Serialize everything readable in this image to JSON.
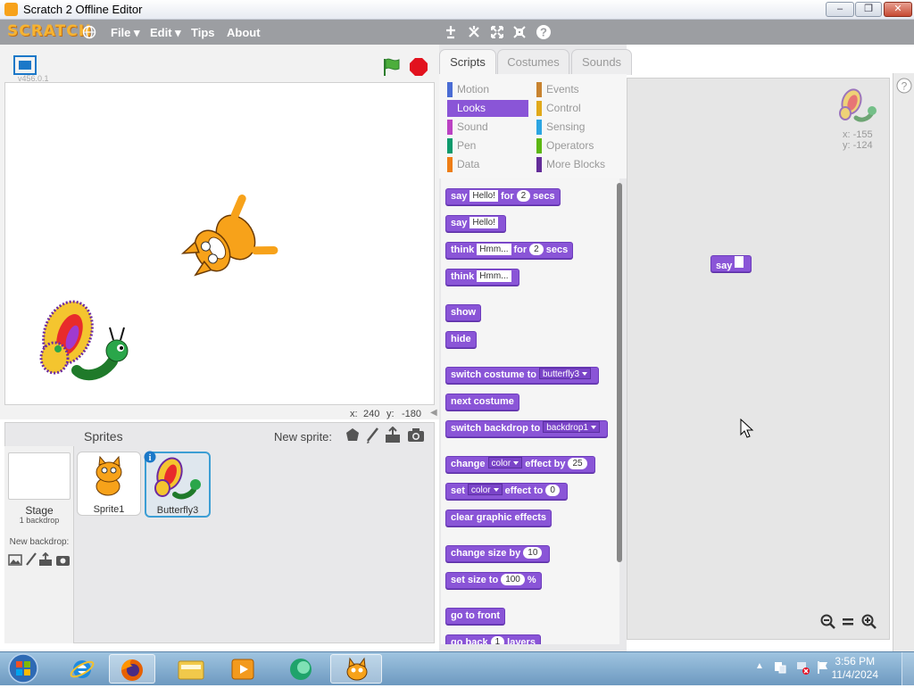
{
  "window": {
    "title": "Scratch 2 Offline Editor",
    "controls": {
      "minimize": "–",
      "maximize": "❐",
      "close": "✕"
    }
  },
  "menubar": {
    "logo": "SCRATCH",
    "items": [
      "File",
      "Edit",
      "Tips",
      "About"
    ],
    "tools": [
      "duplicate-icon",
      "delete-icon",
      "grow-icon",
      "shrink-icon",
      "help-icon"
    ]
  },
  "stage": {
    "version": "v456.0.1",
    "mouse_x_label": "x:",
    "mouse_x": "240",
    "mouse_y_label": "y:",
    "mouse_y": "-180"
  },
  "sprites_pane": {
    "title": "Sprites",
    "new_sprite_label": "New sprite:",
    "stage_label": "Stage",
    "stage_sub": "1 backdrop",
    "new_backdrop_label": "New backdrop:",
    "sprites": [
      {
        "name": "Sprite1",
        "selected": false
      },
      {
        "name": "Butterfly3",
        "selected": true
      }
    ]
  },
  "tabs": [
    "Scripts",
    "Costumes",
    "Sounds"
  ],
  "active_tab": "Scripts",
  "categories": [
    {
      "label": "Motion",
      "color": "#4a6cd4"
    },
    {
      "label": "Events",
      "color": "#c88330"
    },
    {
      "label": "Looks",
      "color": "#8a55d7"
    },
    {
      "label": "Control",
      "color": "#e1a91a"
    },
    {
      "label": "Sound",
      "color": "#bb42c3"
    },
    {
      "label": "Sensing",
      "color": "#2ca5e2"
    },
    {
      "label": "Pen",
      "color": "#0e9a6c"
    },
    {
      "label": "Operators",
      "color": "#5cb712"
    },
    {
      "label": "Data",
      "color": "#ee7d16"
    },
    {
      "label": "More Blocks",
      "color": "#632d99"
    }
  ],
  "active_category": "Looks",
  "blocks": {
    "say_for": {
      "w1": "say",
      "v1": "Hello!",
      "w2": "for",
      "v2": "2",
      "w3": "secs"
    },
    "say": {
      "w1": "say",
      "v1": "Hello!"
    },
    "think_for": {
      "w1": "think",
      "v1": "Hmm...",
      "w2": "for",
      "v2": "2",
      "w3": "secs"
    },
    "think": {
      "w1": "think",
      "v1": "Hmm..."
    },
    "show": "show",
    "hide": "hide",
    "switch_costume": {
      "w1": "switch costume to",
      "v1": "butterfly3"
    },
    "next_costume": "next costume",
    "switch_backdrop": {
      "w1": "switch backdrop to",
      "v1": "backdrop1"
    },
    "change_effect": {
      "w1": "change",
      "v1": "color",
      "w2": "effect by",
      "v2": "25"
    },
    "set_effect": {
      "w1": "set",
      "v1": "color",
      "w2": "effect to",
      "v2": "0"
    },
    "clear_effects": "clear graphic effects",
    "change_size": {
      "w1": "change size by",
      "v1": "10"
    },
    "set_size": {
      "w1": "set size to",
      "v1": "100",
      "w2": "%"
    },
    "go_front": "go to front",
    "go_back": {
      "w1": "go back",
      "v1": "1",
      "w2": "layers"
    }
  },
  "script_area": {
    "sprite_x": "x: -155",
    "sprite_y": "y: -124",
    "placed_block": {
      "w1": "say",
      "v1": ""
    },
    "zoom": [
      "zoom-out-icon",
      "zoom-reset-icon",
      "zoom-in-icon"
    ]
  },
  "taskbar": {
    "time": "3:56 PM",
    "date": "11/4/2024"
  }
}
